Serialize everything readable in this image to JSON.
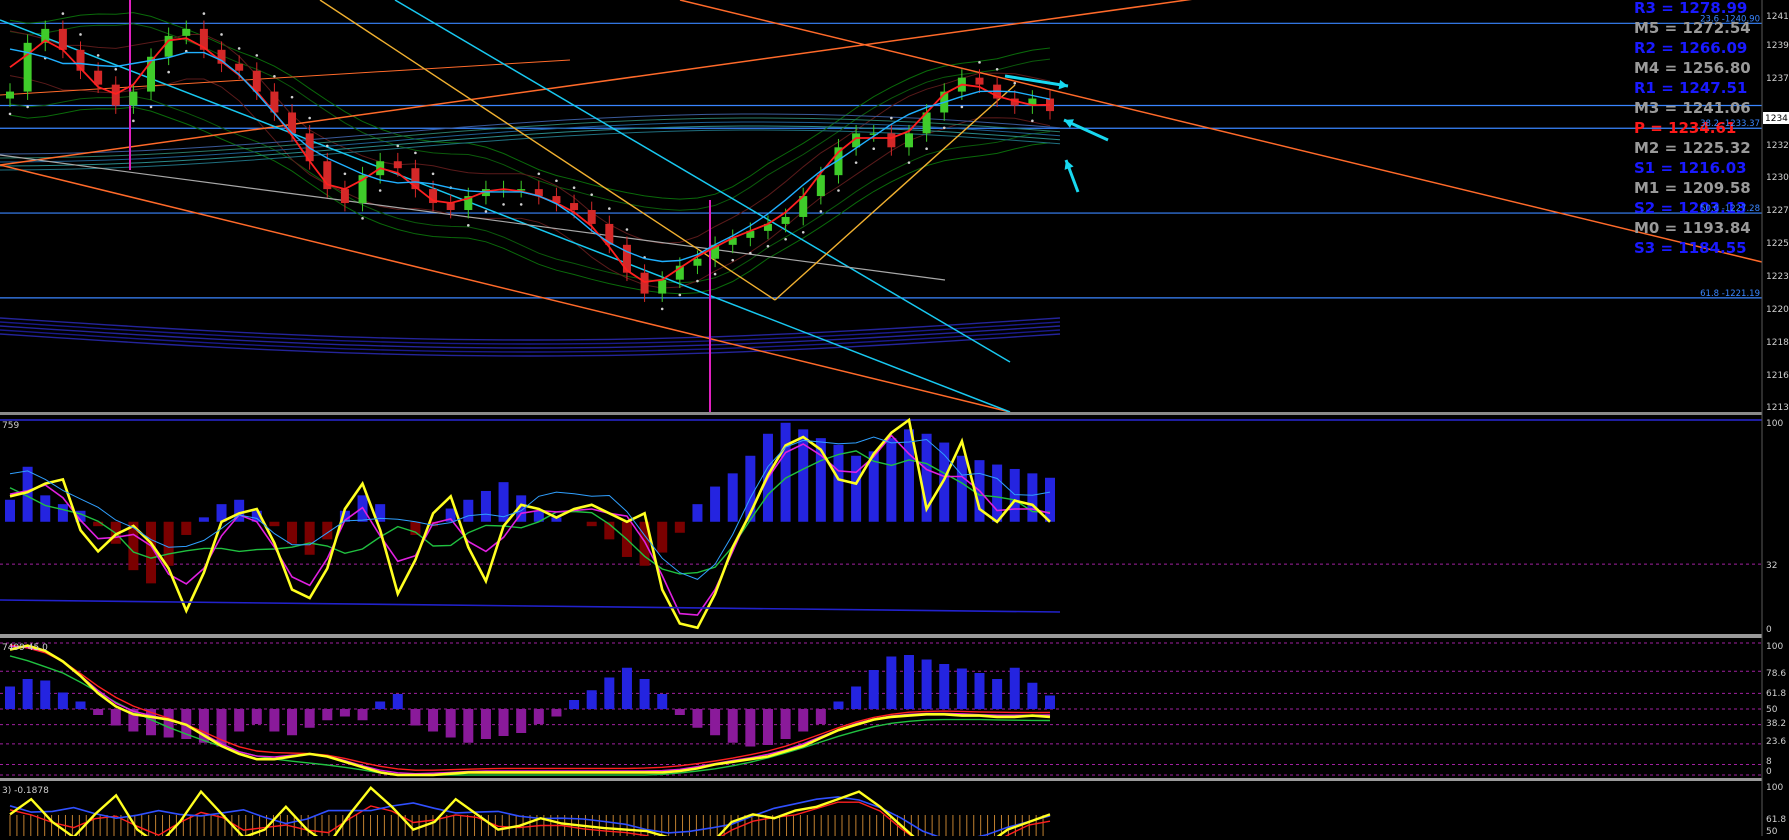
{
  "chart_data": {
    "type": "candlestick",
    "instrument_panel": {
      "y_axis_ticks": [
        "1241",
        "1239",
        "1237",
        "1234",
        "1232",
        "1230",
        "1227",
        "1225",
        "1223",
        "1220",
        "1218",
        "1216",
        "1213"
      ],
      "current_price_label": "1234",
      "ylim": [
        1213,
        1242
      ],
      "pivot_levels": [
        {
          "label": "R3 = 1278.99",
          "color": "#1a1aff"
        },
        {
          "label": "M5 = 1272.54",
          "color": "#9a9a9a"
        },
        {
          "label": "R2 = 1266.09",
          "color": "#1a1aff"
        },
        {
          "label": "M4 = 1256.80",
          "color": "#9a9a9a"
        },
        {
          "label": "R1 = 1247.51",
          "color": "#1a1aff"
        },
        {
          "label": "M3 = 1241.06",
          "color": "#9a9a9a"
        },
        {
          "label": "P  = 1234.61",
          "color": "#ff1a1a"
        },
        {
          "label": "M2 = 1225.32",
          "color": "#9a9a9a"
        },
        {
          "label": "S1 = 1216.03",
          "color": "#1a1aff"
        },
        {
          "label": "M1 = 1209.58",
          "color": "#9a9a9a"
        },
        {
          "label": "S2 = 1203.13",
          "color": "#1a1aff"
        },
        {
          "label": "M0 = 1193.84",
          "color": "#9a9a9a"
        },
        {
          "label": "S3 = 1184.55",
          "color": "#1a1aff"
        }
      ],
      "fibonacci_levels": [
        {
          "label": "23.6 -1240.90",
          "value": 1240.9
        },
        {
          "label": "38.2 -1233.37",
          "value": 1233.37
        },
        {
          "label": "50.0 -1227.28",
          "value": 1227.28
        },
        {
          "label": "61.8 -1221.19",
          "value": 1221.19
        }
      ],
      "extra_level": 1235.0,
      "close_prices": [
        1236,
        1239.5,
        1240.5,
        1239,
        1237.5,
        1236.5,
        1235,
        1236,
        1238.5,
        1240,
        1240.5,
        1239,
        1238,
        1237.5,
        1236,
        1234.5,
        1233,
        1231,
        1229,
        1228,
        1230,
        1231,
        1230.5,
        1229,
        1228,
        1227.5,
        1228.5,
        1229,
        1229,
        1229,
        1228.5,
        1228,
        1227.5,
        1226.5,
        1225,
        1223,
        1221.5,
        1222.5,
        1223.5,
        1224,
        1225,
        1225.5,
        1226,
        1226.5,
        1227,
        1228.5,
        1230,
        1232,
        1233,
        1233,
        1232,
        1233,
        1234.5,
        1236,
        1237,
        1236.5,
        1235.5,
        1235,
        1235.5,
        1234.6
      ]
    },
    "oscillator_panel_1": {
      "header": "759",
      "y_axis_ticks": [
        "100",
        "32",
        "0"
      ],
      "histogram": [
        60,
        75,
        62,
        58,
        55,
        48,
        40,
        28,
        22,
        30,
        44,
        52,
        58,
        60,
        55,
        48,
        40,
        35,
        42,
        55,
        62,
        58,
        50,
        44,
        48,
        56,
        60,
        64,
        68,
        62,
        55,
        52,
        50,
        48,
        42,
        34,
        30,
        36,
        45,
        58,
        66,
        72,
        80,
        90,
        95,
        92,
        88,
        85,
        80,
        82,
        88,
        92,
        90,
        86,
        80,
        78,
        76,
        74,
        72,
        70
      ],
      "stoch_main": [
        64,
        66,
        70,
        72,
        48,
        38,
        46,
        50,
        42,
        30,
        10,
        28,
        52,
        56,
        58,
        42,
        20,
        16,
        30,
        58,
        70,
        48,
        18,
        34,
        56,
        64,
        40,
        24,
        50,
        60,
        58,
        54,
        58,
        60,
        56,
        52,
        56,
        20,
        4,
        2,
        18,
        40,
        56,
        74,
        88,
        92,
        86,
        72,
        70,
        84,
        94,
        100,
        58,
        72,
        90,
        58,
        52,
        62,
        60,
        52
      ]
    },
    "oscillator_panel_2": {
      "header": "7499 45.0",
      "y_axis_ticks": [
        "100",
        "78.6",
        "61.8",
        "50",
        "38.2",
        "23.6",
        "8",
        "0"
      ],
      "levels": [
        100,
        78.6,
        61.8,
        50,
        38.2,
        23.6,
        8,
        0
      ],
      "histogram": [
        30,
        40,
        38,
        22,
        10,
        -8,
        -22,
        -30,
        -35,
        -38,
        -40,
        -45,
        -50,
        -30,
        -20,
        -30,
        -35,
        -25,
        -15,
        -10,
        -15,
        10,
        20,
        -22,
        -30,
        -38,
        -45,
        -40,
        -36,
        -32,
        -20,
        -10,
        12,
        25,
        42,
        55,
        40,
        20,
        -8,
        -25,
        -35,
        -45,
        -50,
        -48,
        -40,
        -30,
        -20,
        10,
        30,
        52,
        70,
        72,
        66,
        60,
        54,
        48,
        40,
        55,
        35,
        18
      ],
      "main_line": [
        95,
        98,
        94,
        86,
        75,
        62,
        52,
        46,
        44,
        42,
        38,
        30,
        22,
        16,
        12,
        12,
        14,
        16,
        14,
        10,
        6,
        2,
        0,
        0,
        0,
        1,
        2,
        2,
        2,
        2,
        2,
        2,
        2,
        2,
        2,
        2,
        2,
        2,
        3,
        5,
        8,
        10,
        12,
        14,
        18,
        22,
        28,
        34,
        38,
        42,
        44,
        45,
        46,
        46,
        45,
        45,
        44,
        44,
        45,
        44
      ]
    },
    "oscillator_panel_3": {
      "header": "3) -0.1878",
      "y_axis_ticks": [
        "100",
        "61.8",
        "50"
      ],
      "main_line": [
        60,
        80,
        50,
        30,
        60,
        85,
        40,
        20,
        50,
        90,
        60,
        30,
        40,
        70,
        40,
        20,
        60,
        95,
        70,
        40,
        50,
        80,
        60,
        40,
        45,
        55,
        48,
        45,
        42,
        40,
        38,
        30,
        10,
        20,
        50,
        60,
        55,
        65,
        70,
        80,
        90,
        70,
        45,
        20,
        10,
        5,
        20,
        40,
        50,
        60
      ]
    }
  }
}
